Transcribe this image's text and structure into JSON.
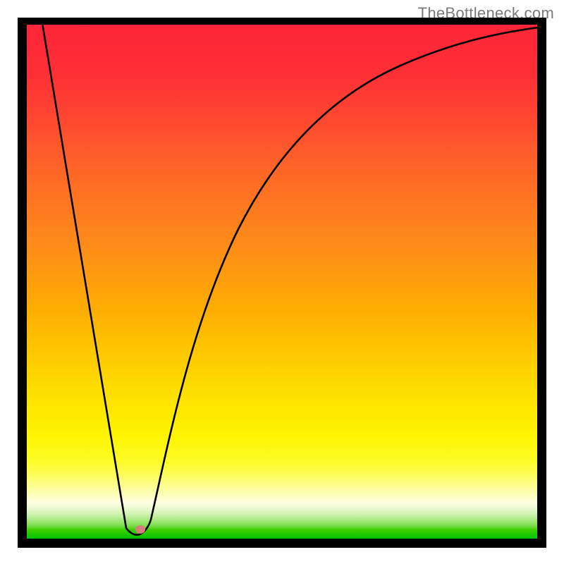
{
  "watermark": "TheBottleneck.com",
  "chart_data": {
    "type": "line",
    "title": "",
    "xlabel": "",
    "ylabel": "",
    "xlim": [
      0,
      100
    ],
    "ylim": [
      0,
      100
    ],
    "grid": false,
    "legend": false,
    "background": "vertical-gradient red→orange→yellow→green",
    "series": [
      {
        "name": "bottleneck-curve",
        "x": [
          3,
          6,
          9,
          12,
          15,
          18,
          19.5,
          21,
          22.5,
          24,
          27,
          30,
          34,
          38,
          42,
          46,
          52,
          58,
          66,
          74,
          82,
          90,
          100
        ],
        "y": [
          102,
          82,
          61,
          41,
          21,
          6,
          2,
          0.5,
          1.5,
          3.5,
          12,
          23,
          38,
          50,
          59,
          67,
          76,
          82,
          88,
          92,
          95,
          97.5,
          99.5
        ]
      }
    ],
    "markers": [
      {
        "name": "optimal-point",
        "x": 22.3,
        "y": 1.8,
        "color": "#d77e7e"
      }
    ],
    "gradient_stops": [
      {
        "pos": 0.0,
        "color": "#fe2638"
      },
      {
        "pos": 0.29,
        "color": "#fe6826"
      },
      {
        "pos": 0.55,
        "color": "#fead02"
      },
      {
        "pos": 0.8,
        "color": "#fef400"
      },
      {
        "pos": 0.94,
        "color": "#e2f7c7"
      },
      {
        "pos": 1.0,
        "color": "#00c400"
      }
    ]
  }
}
